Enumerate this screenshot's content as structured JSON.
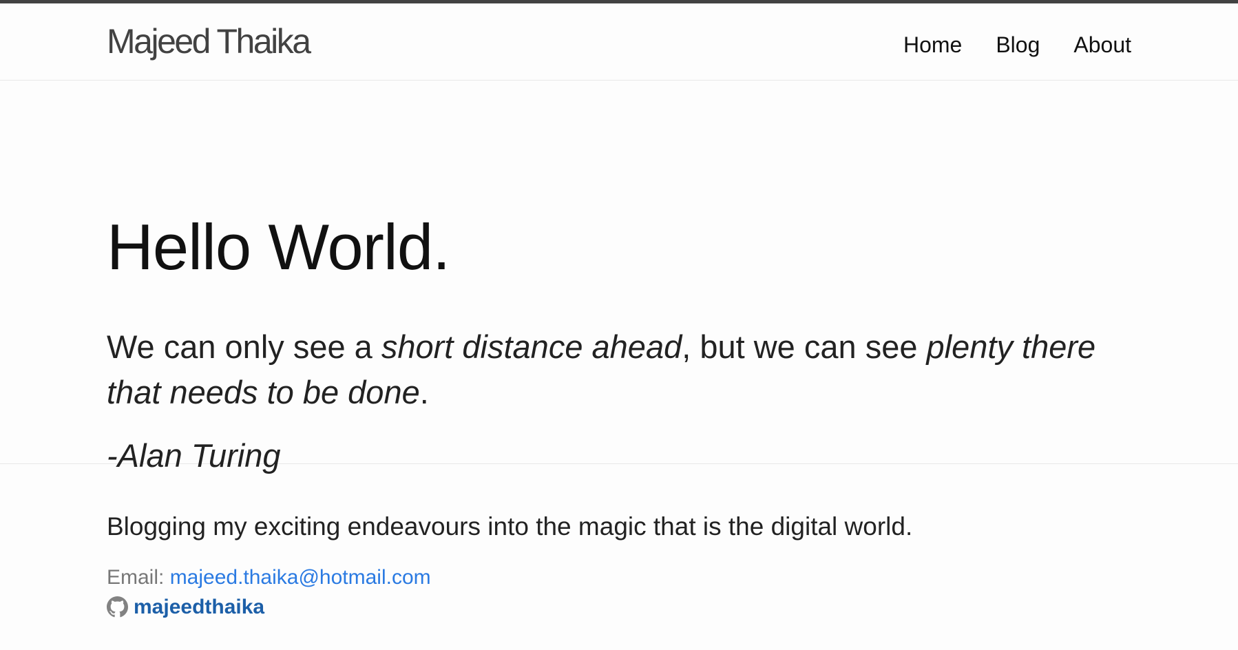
{
  "header": {
    "site_title": "Majeed Thaika",
    "nav": [
      {
        "label": "Home"
      },
      {
        "label": "Blog"
      },
      {
        "label": "About"
      }
    ]
  },
  "main": {
    "headline": "Hello World.",
    "quote": {
      "part1": "We can only see a ",
      "emph1": "short distance ahead",
      "part2": ", but we can see ",
      "emph2": "plenty there that needs to be done",
      "part3": "."
    },
    "attribution": "-Alan Turing"
  },
  "footer": {
    "tagline": "Blogging my exciting endeavours into the magic that is the digital world.",
    "email_label": "Email: ",
    "email": "majeed.thaika@hotmail.com",
    "github_username": "majeedthaika",
    "github_icon": "github-icon"
  },
  "colors": {
    "top_bar": "#424242",
    "link": "#2a7ae2",
    "github_link": "#1c5fa8",
    "text": "#111111"
  }
}
